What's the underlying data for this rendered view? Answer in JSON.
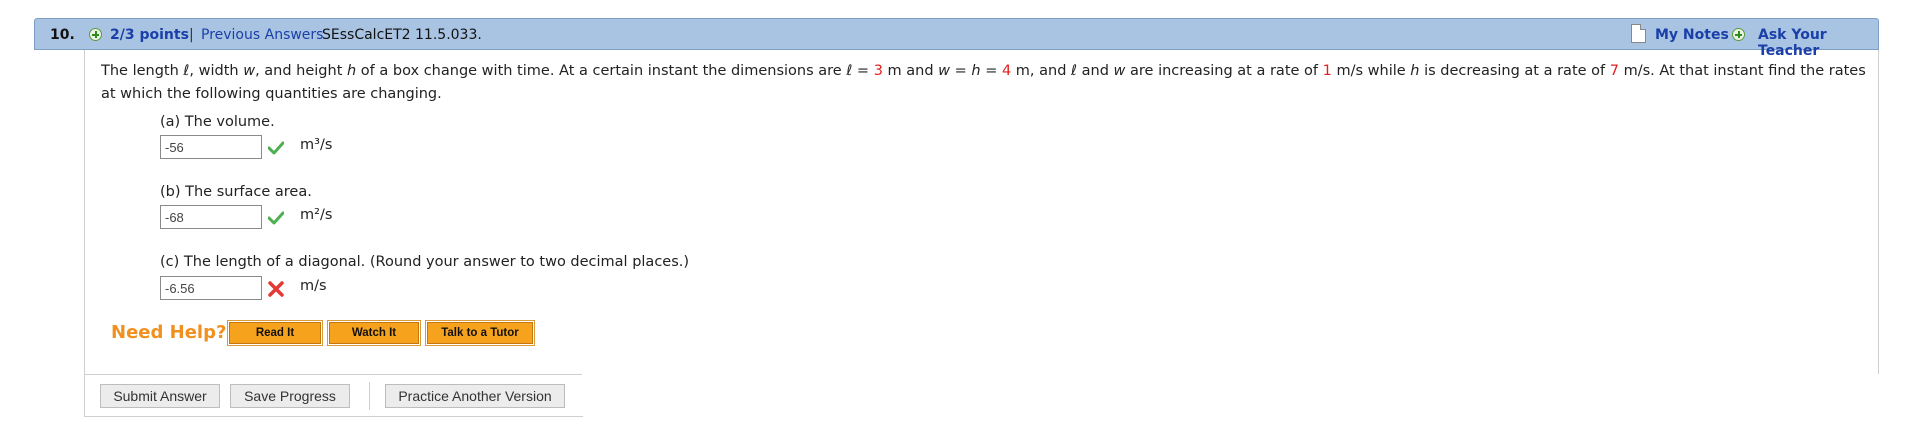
{
  "header": {
    "number": "10.",
    "points": "2/3 points",
    "separator": "|",
    "previous_answers": "Previous Answers",
    "code": "SEssCalcET2 11.5.033.",
    "my_notes": "My Notes",
    "ask_teacher": "Ask Your Teacher"
  },
  "problem": {
    "s1": "The length ",
    "l1": "ℓ",
    "s2": ", width ",
    "w1": "w",
    "s3": ", and height ",
    "h1": "h",
    "s4": " of a box change with time. At a certain instant the dimensions are ",
    "l2": "ℓ",
    "s5": " = ",
    "v_l": "3",
    "s6": " m and  ",
    "w2": "w",
    "s7": " = ",
    "h2": "h",
    "s8": " = ",
    "v_wh": "4",
    "s9": " m,  and ",
    "l3": "ℓ",
    "s10": " and ",
    "w3": "w",
    "s11": " are increasing at a rate of ",
    "v_rate1": "1",
    "s12": " m/s while ",
    "h3": "h",
    "s13": " is decreasing at a rate of ",
    "v_rate2": "7",
    "s14": " m/s. At that instant find the rates at which the following quantities are changing."
  },
  "parts": [
    {
      "label": "(a) The volume.",
      "value": "-56",
      "status": "correct",
      "unit": "m³/s"
    },
    {
      "label": "(b) The surface area.",
      "value": "-68",
      "status": "correct",
      "unit": "m²/s"
    },
    {
      "label": "(c) The length of a diagonal. (Round your answer to two decimal places.)",
      "value": "-6.56",
      "status": "incorrect",
      "unit": "m/s"
    }
  ],
  "help": {
    "title": "Need Help?",
    "read": "Read It",
    "watch": "Watch It",
    "tutor": "Talk to a Tutor"
  },
  "footer": {
    "submit": "Submit Answer",
    "save": "Save Progress",
    "practice": "Practice Another Version"
  },
  "colors": {
    "header_bar": "#a9c4e2",
    "link": "#1a3fa8",
    "highlight_value": "#e02020",
    "help_title": "#f0901e",
    "help_button": "#f7a21d",
    "check": "#4caf50",
    "cross": "#e53935"
  },
  "icons": {
    "points_icon": "green-plus-circle",
    "notes_icon": "document",
    "ask_icon": "green-plus-circle",
    "correct_icon": "checkmark",
    "incorrect_icon": "x-mark"
  }
}
